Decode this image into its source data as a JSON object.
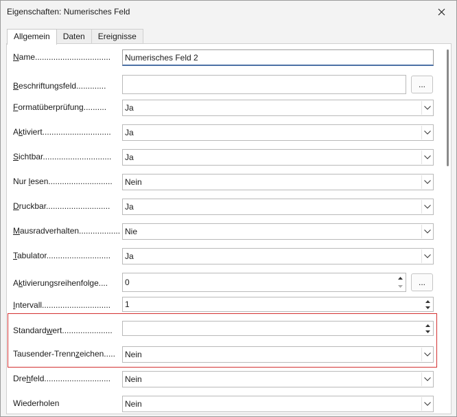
{
  "window": {
    "title": "Eigenschaften: Numerisches Feld",
    "close_icon": "close-icon"
  },
  "tabs": [
    {
      "label": "Allgemein",
      "active": true
    },
    {
      "label": "Daten",
      "active": false
    },
    {
      "label": "Ereignisse",
      "active": false
    }
  ],
  "fields": {
    "name": {
      "label_pre": "",
      "label_ul": "N",
      "label_post": "ame.................................",
      "value": "Numerisches Feld 2"
    },
    "beschriftungsfeld": {
      "label_pre": "",
      "label_ul": "B",
      "label_post": "eschriftungsfeld.............",
      "value": "",
      "button": "..."
    },
    "formatueberpruefung": {
      "label_pre": "",
      "label_ul": "F",
      "label_post": "ormatüberprüfung..........",
      "value": "Ja"
    },
    "aktiviert": {
      "label_pre": "A",
      "label_ul": "k",
      "label_post": "tiviert..............................",
      "value": "Ja"
    },
    "sichtbar": {
      "label_pre": "",
      "label_ul": "S",
      "label_post": "ichtbar..............................",
      "value": "Ja"
    },
    "nur_lesen": {
      "label_pre": "Nur ",
      "label_ul": "l",
      "label_post": "esen............................",
      "value": "Nein"
    },
    "druckbar": {
      "label_pre": "",
      "label_ul": "D",
      "label_post": "ruckbar............................",
      "value": "Ja"
    },
    "mausrad": {
      "label_pre": "",
      "label_ul": "M",
      "label_post": "ausradverhalten..................",
      "value": "Nie"
    },
    "tabulator": {
      "label_pre": "",
      "label_ul": "T",
      "label_post": "abulator............................",
      "value": "Ja"
    },
    "aktivierungsreihenfolge": {
      "label_pre": "A",
      "label_ul": "k",
      "label_post": "tivierungsreihenfolge....",
      "value": "0",
      "button": "..."
    },
    "intervall": {
      "label_pre": "",
      "label_ul": "I",
      "label_post": "ntervall..............................",
      "value": "1"
    },
    "standardwert": {
      "label_pre": "Standard",
      "label_ul": "w",
      "label_post": "ert......................",
      "value": ""
    },
    "tausender": {
      "label_pre": "Tausender-Trenn",
      "label_ul": "z",
      "label_post": "eichen.....",
      "value": "Nein"
    },
    "drehfeld": {
      "label_pre": "Dre",
      "label_ul": "h",
      "label_post": "feld.............................",
      "value": "Nein"
    },
    "wiederholen": {
      "label_pre": "Wiederholen",
      "label_ul": "",
      "label_post": "",
      "value": "Nein"
    }
  }
}
